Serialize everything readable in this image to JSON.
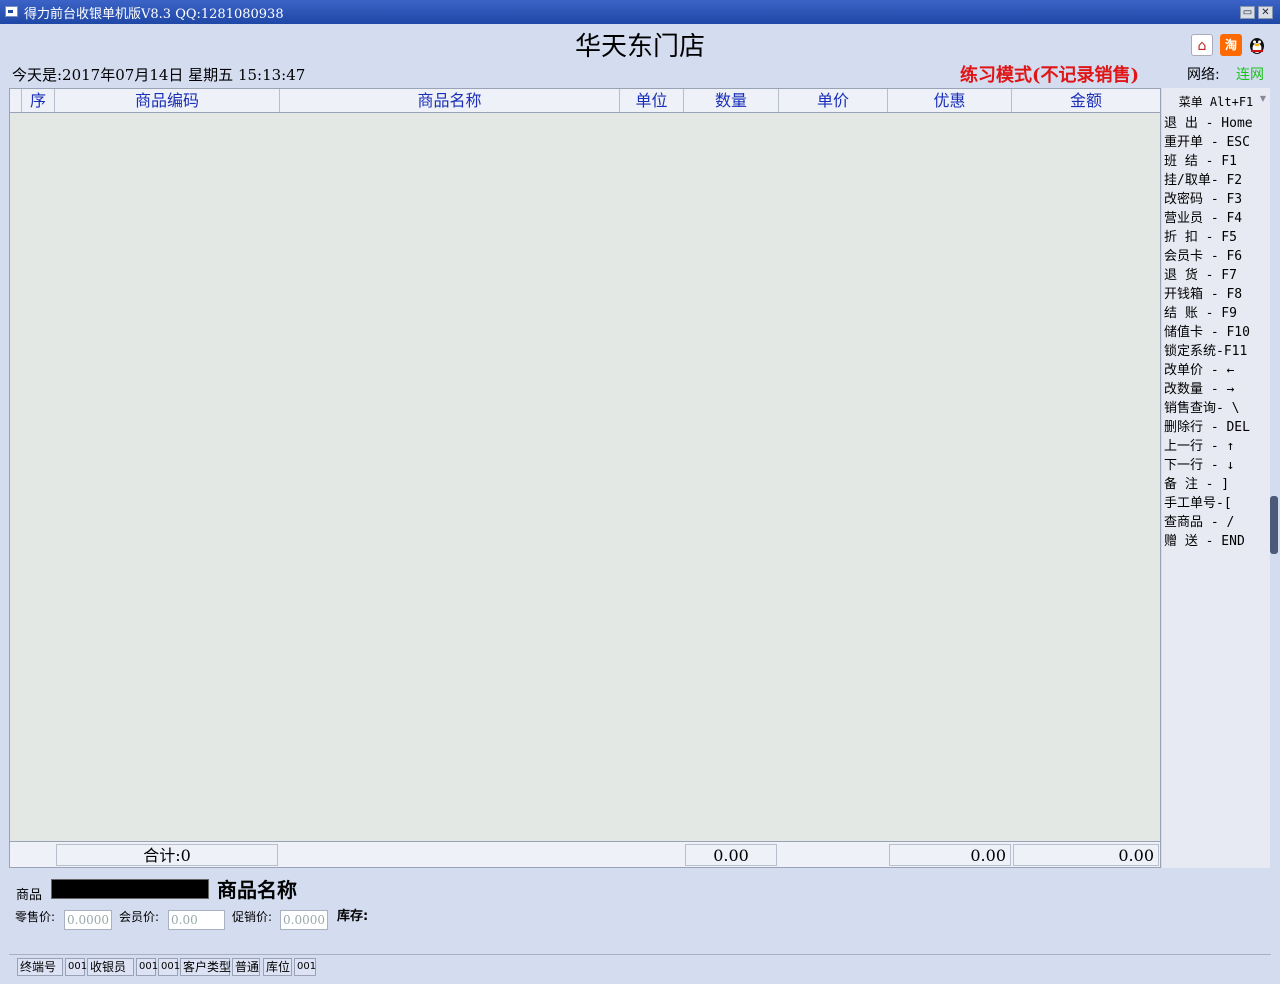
{
  "window": {
    "title": "得力前台收银单机版V8.3 QQ:1281080938",
    "minimize_glyph": "▭",
    "close_glyph": "✕"
  },
  "header": {
    "store_name": "华天东门店",
    "date_line": "今天是:2017年07月14日 星期五 15:13:47",
    "mode_text": "练习模式(不记录销售)",
    "network_label": "网络:",
    "network_value": "连网",
    "network_color": "#1cc21c",
    "icons": [
      "home-icon",
      "taobao-icon",
      "qq-penguin-icon"
    ],
    "taobao_glyph": "淘"
  },
  "grid": {
    "columns": [
      "序",
      "商品编码",
      "商品名称",
      "单位",
      "数量",
      "单价",
      "优惠",
      "金额"
    ],
    "rows": [],
    "footer": {
      "total_label": "合计:0",
      "quantity_total": "0.00",
      "discount_total": "0.00",
      "amount_total": "0.00"
    }
  },
  "menu": {
    "title": "菜单 Alt+F1",
    "items": [
      "退  出 - Home",
      "重开单 - ESC",
      "班  结 - F1",
      "挂/取单- F2",
      "改密码 - F3",
      "营业员 - F4",
      "折  扣 - F5",
      "会员卡 - F6",
      "退  货 - F7",
      "开钱箱 - F8",
      "结  账 - F9",
      "储值卡 - F10",
      "锁定系统-F11",
      "改单价 - ←",
      "改数量 - →",
      "销售查询- \\",
      "删除行 - DEL",
      "上一行 - ↑",
      "下一行 - ↓",
      "备  注 - ]",
      "手工单号-[",
      "查商品 - /",
      "赠  送 - END"
    ]
  },
  "product": {
    "label": "商品",
    "name_placeholder": "商品名称",
    "retail_label": "零售价:",
    "retail_value": "0.0000",
    "member_label": "会员价:",
    "member_value": "0.00",
    "promo_label": "促销价:",
    "promo_value": "0.0000",
    "stock_label": "库存:"
  },
  "status": {
    "terminal_label": "终端号",
    "terminal_value": "001",
    "cashier_label": "收银员",
    "cashier_code": "001",
    "cashier_name": "001",
    "customer_type_label": "客户类型",
    "customer_type_value": "普通",
    "location_label": "库位",
    "location_value": "001"
  }
}
